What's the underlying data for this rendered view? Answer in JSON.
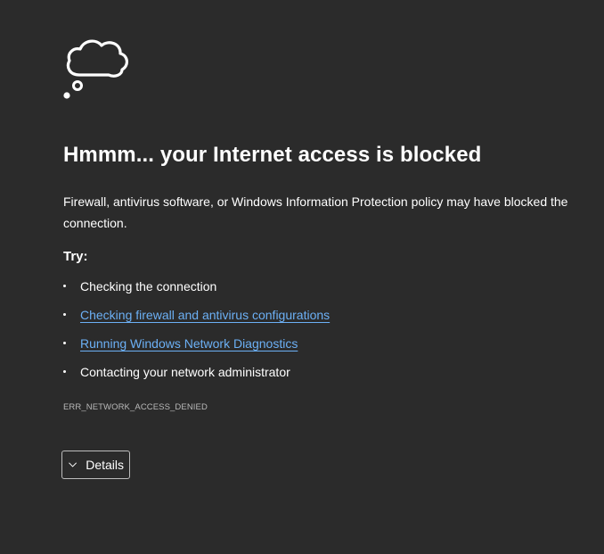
{
  "error": {
    "title": "Hmmm... your Internet access is blocked",
    "description": "Firewall, antivirus software, or Windows Information Protection policy may have blocked the connection.",
    "try_label": "Try:",
    "suggestions": [
      {
        "text": "Checking the connection",
        "is_link": false
      },
      {
        "text": "Checking firewall and antivirus configurations",
        "is_link": true
      },
      {
        "text": "Running Windows Network Diagnostics",
        "is_link": true
      },
      {
        "text": "Contacting your network administrator",
        "is_link": false
      }
    ],
    "code": "ERR_NETWORK_ACCESS_DENIED",
    "details_label": "Details"
  },
  "icons": {
    "illustration": "thought-cloud-icon",
    "details_toggle": "chevron-down-icon"
  },
  "colors": {
    "background": "#2b2b2b",
    "text": "#ffffff",
    "link": "#6cb0f5",
    "muted": "#b9b9b9"
  }
}
